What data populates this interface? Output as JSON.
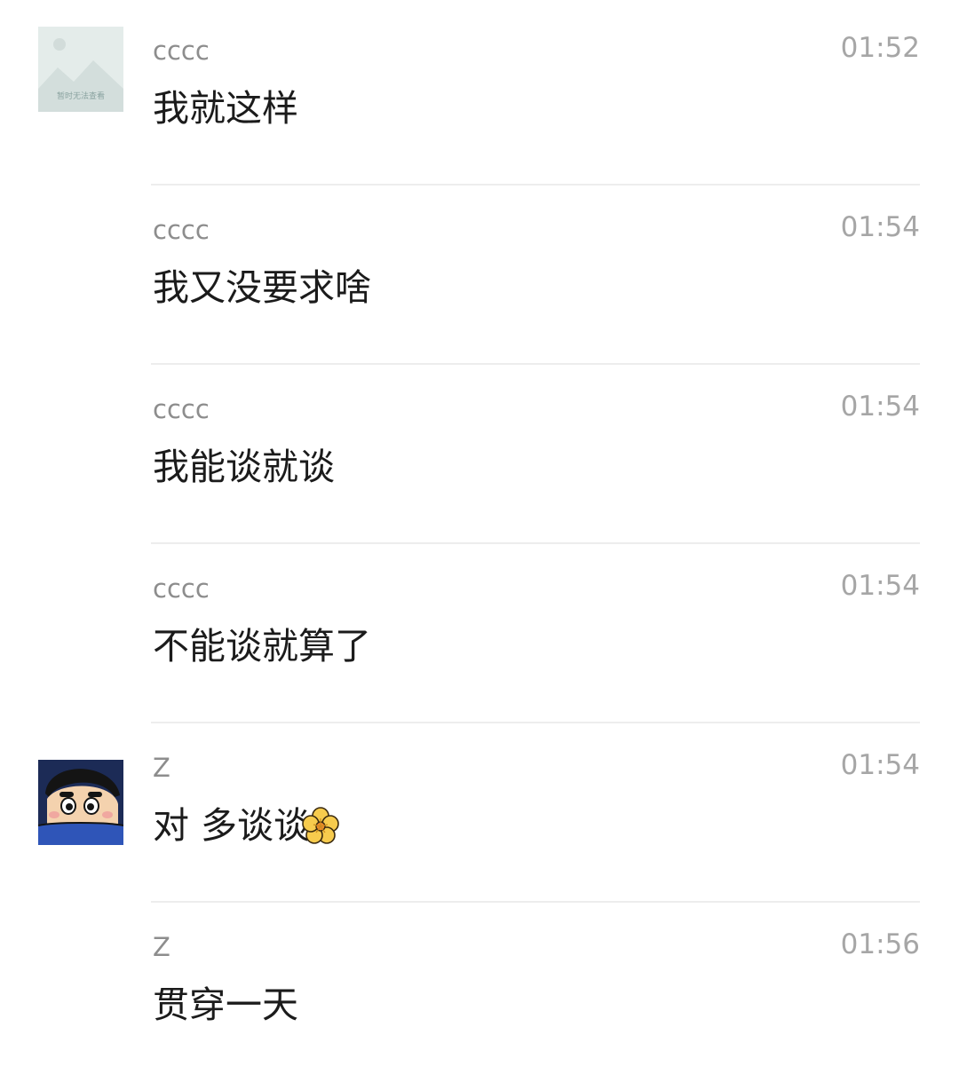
{
  "messages": [
    {
      "sender": "cccc",
      "time": "01:52",
      "text": "我就这样",
      "avatar": "image-unavailable-placeholder",
      "avatar_caption": "暂时无法查看"
    },
    {
      "sender": "cccc",
      "time": "01:54",
      "text": "我又没要求啥"
    },
    {
      "sender": "cccc",
      "time": "01:54",
      "text": "我能谈就谈"
    },
    {
      "sender": "cccc",
      "time": "01:54",
      "text": "不能谈就算了"
    },
    {
      "sender": "Z",
      "time": "01:54",
      "text": "对 多谈谈",
      "emoji": "flower-icon",
      "avatar": "cartoon-boy-avatar"
    },
    {
      "sender": "Z",
      "time": "01:56",
      "text": "贯穿一天"
    }
  ],
  "colors": {
    "sender": "#8d8d8d",
    "time": "#a6a6a6",
    "text": "#1b1b1b",
    "divider": "#ededed",
    "avatar_navy": "#1c2b56"
  }
}
